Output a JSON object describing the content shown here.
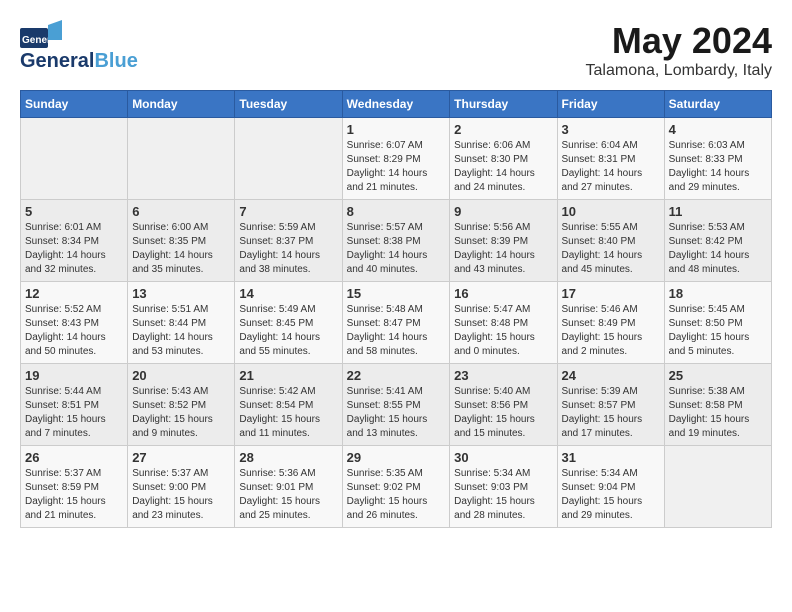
{
  "header": {
    "logo_general": "General",
    "logo_blue": "Blue",
    "title": "May 2024",
    "subtitle": "Talamona, Lombardy, Italy"
  },
  "weekdays": [
    "Sunday",
    "Monday",
    "Tuesday",
    "Wednesday",
    "Thursday",
    "Friday",
    "Saturday"
  ],
  "weeks": [
    [
      {
        "day": "",
        "sunrise": "",
        "sunset": "",
        "daylight": ""
      },
      {
        "day": "",
        "sunrise": "",
        "sunset": "",
        "daylight": ""
      },
      {
        "day": "",
        "sunrise": "",
        "sunset": "",
        "daylight": ""
      },
      {
        "day": "1",
        "sunrise": "Sunrise: 6:07 AM",
        "sunset": "Sunset: 8:29 PM",
        "daylight": "Daylight: 14 hours and 21 minutes."
      },
      {
        "day": "2",
        "sunrise": "Sunrise: 6:06 AM",
        "sunset": "Sunset: 8:30 PM",
        "daylight": "Daylight: 14 hours and 24 minutes."
      },
      {
        "day": "3",
        "sunrise": "Sunrise: 6:04 AM",
        "sunset": "Sunset: 8:31 PM",
        "daylight": "Daylight: 14 hours and 27 minutes."
      },
      {
        "day": "4",
        "sunrise": "Sunrise: 6:03 AM",
        "sunset": "Sunset: 8:33 PM",
        "daylight": "Daylight: 14 hours and 29 minutes."
      }
    ],
    [
      {
        "day": "5",
        "sunrise": "Sunrise: 6:01 AM",
        "sunset": "Sunset: 8:34 PM",
        "daylight": "Daylight: 14 hours and 32 minutes."
      },
      {
        "day": "6",
        "sunrise": "Sunrise: 6:00 AM",
        "sunset": "Sunset: 8:35 PM",
        "daylight": "Daylight: 14 hours and 35 minutes."
      },
      {
        "day": "7",
        "sunrise": "Sunrise: 5:59 AM",
        "sunset": "Sunset: 8:37 PM",
        "daylight": "Daylight: 14 hours and 38 minutes."
      },
      {
        "day": "8",
        "sunrise": "Sunrise: 5:57 AM",
        "sunset": "Sunset: 8:38 PM",
        "daylight": "Daylight: 14 hours and 40 minutes."
      },
      {
        "day": "9",
        "sunrise": "Sunrise: 5:56 AM",
        "sunset": "Sunset: 8:39 PM",
        "daylight": "Daylight: 14 hours and 43 minutes."
      },
      {
        "day": "10",
        "sunrise": "Sunrise: 5:55 AM",
        "sunset": "Sunset: 8:40 PM",
        "daylight": "Daylight: 14 hours and 45 minutes."
      },
      {
        "day": "11",
        "sunrise": "Sunrise: 5:53 AM",
        "sunset": "Sunset: 8:42 PM",
        "daylight": "Daylight: 14 hours and 48 minutes."
      }
    ],
    [
      {
        "day": "12",
        "sunrise": "Sunrise: 5:52 AM",
        "sunset": "Sunset: 8:43 PM",
        "daylight": "Daylight: 14 hours and 50 minutes."
      },
      {
        "day": "13",
        "sunrise": "Sunrise: 5:51 AM",
        "sunset": "Sunset: 8:44 PM",
        "daylight": "Daylight: 14 hours and 53 minutes."
      },
      {
        "day": "14",
        "sunrise": "Sunrise: 5:49 AM",
        "sunset": "Sunset: 8:45 PM",
        "daylight": "Daylight: 14 hours and 55 minutes."
      },
      {
        "day": "15",
        "sunrise": "Sunrise: 5:48 AM",
        "sunset": "Sunset: 8:47 PM",
        "daylight": "Daylight: 14 hours and 58 minutes."
      },
      {
        "day": "16",
        "sunrise": "Sunrise: 5:47 AM",
        "sunset": "Sunset: 8:48 PM",
        "daylight": "Daylight: 15 hours and 0 minutes."
      },
      {
        "day": "17",
        "sunrise": "Sunrise: 5:46 AM",
        "sunset": "Sunset: 8:49 PM",
        "daylight": "Daylight: 15 hours and 2 minutes."
      },
      {
        "day": "18",
        "sunrise": "Sunrise: 5:45 AM",
        "sunset": "Sunset: 8:50 PM",
        "daylight": "Daylight: 15 hours and 5 minutes."
      }
    ],
    [
      {
        "day": "19",
        "sunrise": "Sunrise: 5:44 AM",
        "sunset": "Sunset: 8:51 PM",
        "daylight": "Daylight: 15 hours and 7 minutes."
      },
      {
        "day": "20",
        "sunrise": "Sunrise: 5:43 AM",
        "sunset": "Sunset: 8:52 PM",
        "daylight": "Daylight: 15 hours and 9 minutes."
      },
      {
        "day": "21",
        "sunrise": "Sunrise: 5:42 AM",
        "sunset": "Sunset: 8:54 PM",
        "daylight": "Daylight: 15 hours and 11 minutes."
      },
      {
        "day": "22",
        "sunrise": "Sunrise: 5:41 AM",
        "sunset": "Sunset: 8:55 PM",
        "daylight": "Daylight: 15 hours and 13 minutes."
      },
      {
        "day": "23",
        "sunrise": "Sunrise: 5:40 AM",
        "sunset": "Sunset: 8:56 PM",
        "daylight": "Daylight: 15 hours and 15 minutes."
      },
      {
        "day": "24",
        "sunrise": "Sunrise: 5:39 AM",
        "sunset": "Sunset: 8:57 PM",
        "daylight": "Daylight: 15 hours and 17 minutes."
      },
      {
        "day": "25",
        "sunrise": "Sunrise: 5:38 AM",
        "sunset": "Sunset: 8:58 PM",
        "daylight": "Daylight: 15 hours and 19 minutes."
      }
    ],
    [
      {
        "day": "26",
        "sunrise": "Sunrise: 5:37 AM",
        "sunset": "Sunset: 8:59 PM",
        "daylight": "Daylight: 15 hours and 21 minutes."
      },
      {
        "day": "27",
        "sunrise": "Sunrise: 5:37 AM",
        "sunset": "Sunset: 9:00 PM",
        "daylight": "Daylight: 15 hours and 23 minutes."
      },
      {
        "day": "28",
        "sunrise": "Sunrise: 5:36 AM",
        "sunset": "Sunset: 9:01 PM",
        "daylight": "Daylight: 15 hours and 25 minutes."
      },
      {
        "day": "29",
        "sunrise": "Sunrise: 5:35 AM",
        "sunset": "Sunset: 9:02 PM",
        "daylight": "Daylight: 15 hours and 26 minutes."
      },
      {
        "day": "30",
        "sunrise": "Sunrise: 5:34 AM",
        "sunset": "Sunset: 9:03 PM",
        "daylight": "Daylight: 15 hours and 28 minutes."
      },
      {
        "day": "31",
        "sunrise": "Sunrise: 5:34 AM",
        "sunset": "Sunset: 9:04 PM",
        "daylight": "Daylight: 15 hours and 29 minutes."
      },
      {
        "day": "",
        "sunrise": "",
        "sunset": "",
        "daylight": ""
      }
    ]
  ]
}
